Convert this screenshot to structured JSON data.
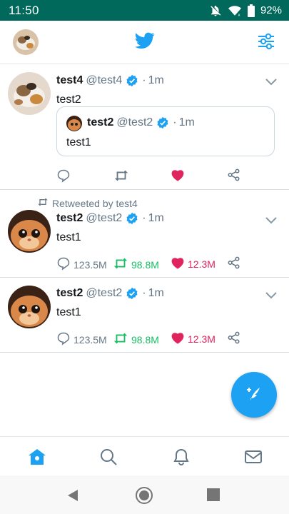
{
  "status_bar": {
    "time": "11:50",
    "battery": "92%"
  },
  "colors": {
    "twitter_blue": "#1da1f2",
    "retweet_green": "#17bf63",
    "like_red": "#e0245e",
    "status_bar": "#00695c"
  },
  "tweets": [
    {
      "name": "test4",
      "handle": "@test4",
      "dot": "·",
      "time": "1m",
      "text": "test2",
      "quoted": {
        "name": "test2",
        "handle": "@test2",
        "dot": "·",
        "time": "1m",
        "text": "test1"
      },
      "liked": true
    },
    {
      "retweeted_by": "Retweeted by test4",
      "name": "test2",
      "handle": "@test2",
      "dot": "·",
      "time": "1m",
      "text": "test1",
      "replies": "123.5M",
      "retweets": "98.8M",
      "likes": "12.3M"
    },
    {
      "name": "test2",
      "handle": "@test2",
      "dot": "·",
      "time": "1m",
      "text": "test1",
      "replies": "123.5M",
      "retweets": "98.8M",
      "likes": "12.3M"
    }
  ],
  "icons": {
    "app_bar": [
      "profile-avatar",
      "twitter-bird-icon",
      "filter-sliders-icon"
    ],
    "bottom_nav": [
      "home-icon",
      "search-icon",
      "notifications-bell-icon",
      "messages-mail-icon"
    ],
    "fab": "compose-tweet-icon"
  }
}
